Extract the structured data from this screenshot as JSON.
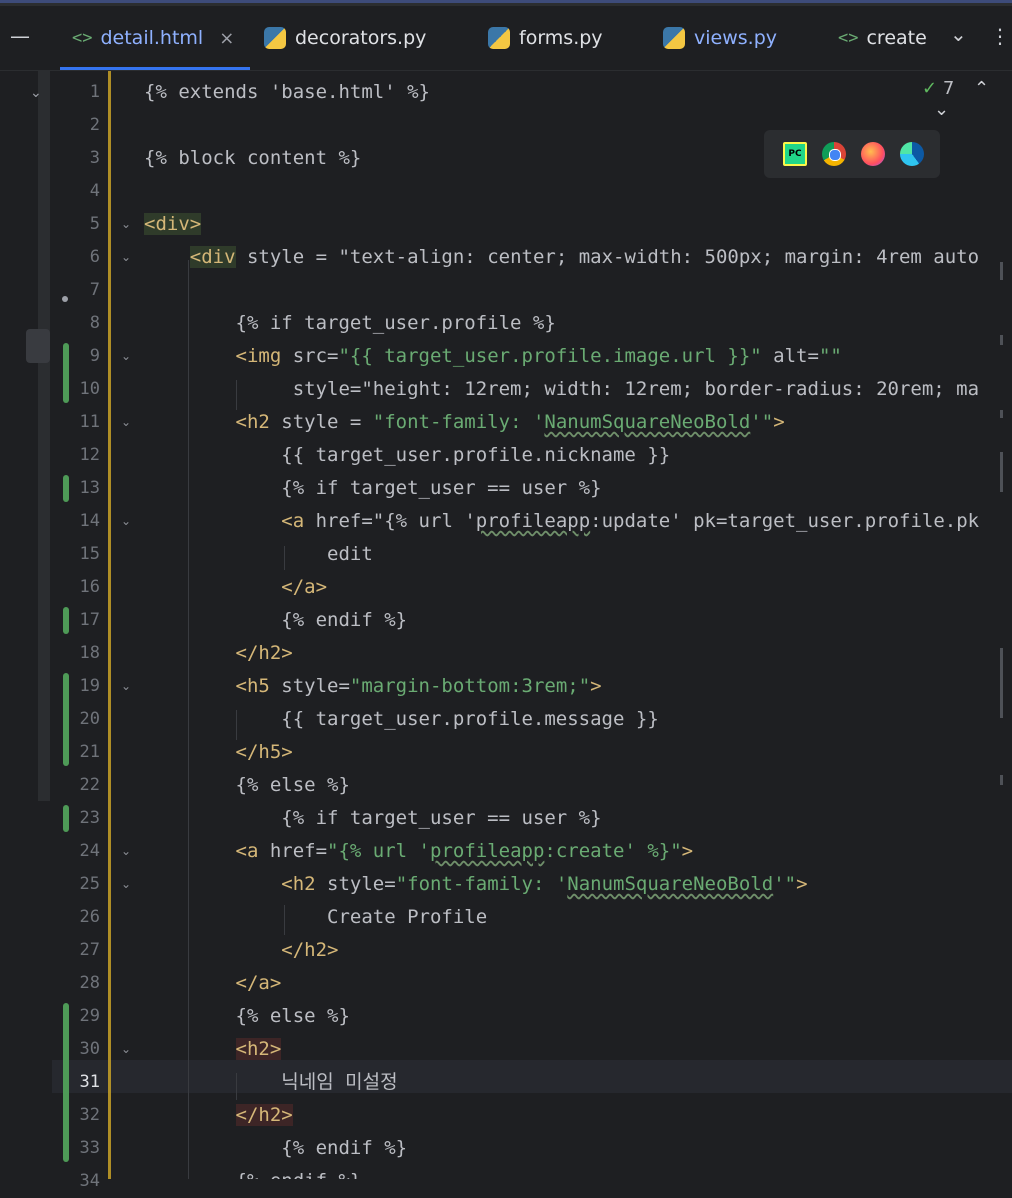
{
  "tabs": [
    {
      "label": "detail.html",
      "icon": "html-icon",
      "active": true
    },
    {
      "label": "decorators.py",
      "icon": "python-icon"
    },
    {
      "label": "forms.py",
      "icon": "python-icon"
    },
    {
      "label": "views.py",
      "icon": "python-icon"
    },
    {
      "label": "create",
      "icon": "html-icon"
    }
  ],
  "icons": {
    "html": "<>",
    "close": "×",
    "dropdown": "⌄",
    "more": "⋮",
    "menu": "—"
  },
  "inspection": {
    "check": "✓",
    "count": "7"
  },
  "browsers": [
    "pycharm-icon",
    "chrome-icon",
    "firefox-icon",
    "edge-icon"
  ],
  "browser_badge": "PC",
  "current_line": 31,
  "lines": [
    "{% extends 'base.html' %}",
    "",
    "{% block content %}",
    "",
    "<div>",
    "    <div style = \"text-align: center; max-width: 500px; margin: 4rem auto",
    "",
    "        {% if target_user.profile %}",
    "        <img src=\"{{ target_user.profile.image.url }}\" alt=\"\"",
    "             style=\"height: 12rem; width: 12rem; border-radius: 20rem; ma",
    "        <h2 style = \"font-family: 'NanumSquareNeoBold'\">",
    "            {{ target_user.profile.nickname }}",
    "            {% if target_user == user %}",
    "            <a href=\"{% url 'profileapp:update' pk=target_user.profile.pk",
    "                edit",
    "            </a>",
    "            {% endif %}",
    "        </h2>",
    "        <h5 style=\"margin-bottom:3rem;\">",
    "            {{ target_user.profile.message }}",
    "        </h5>",
    "        {% else %}",
    "            {% if target_user == user %}",
    "        <a href=\"{% url 'profileapp:create' %}\">",
    "            <h2 style=\"font-family: 'NanumSquareNeoBold'\">",
    "                Create Profile",
    "            </h2>",
    "        </a>",
    "        {% else %}",
    "        <h2>",
    "            닉네임 미설정",
    "        </h2>",
    "            {% endif %}",
    "        {% endif %}"
  ]
}
